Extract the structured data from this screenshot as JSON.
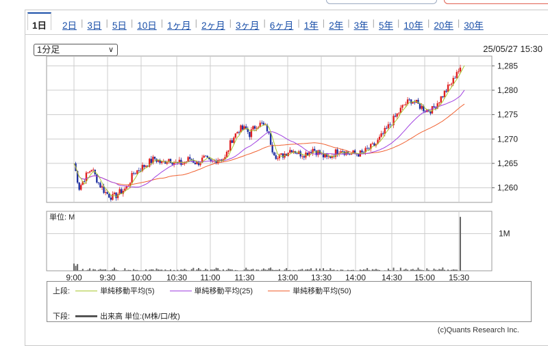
{
  "tabs": [
    "1日",
    "2日",
    "3日",
    "5日",
    "10日",
    "1ヶ月",
    "2ヶ月",
    "3ヶ月",
    "6ヶ月",
    "1年",
    "2年",
    "3年",
    "5年",
    "10年",
    "20年",
    "30年"
  ],
  "interval_select": "1分足",
  "timestamp": "25/05/27 15:30",
  "legend": {
    "upper_label": "上段:",
    "lower_label": "下段:",
    "items": [
      {
        "label": "単純移動平均(5)",
        "color": "#a8c830"
      },
      {
        "label": "単純移動平均(25)",
        "color": "#a040e0"
      },
      {
        "label": "単純移動平均(50)",
        "color": "#f06030"
      }
    ],
    "volume_label": "出来高 単位:(M株/口/枚)"
  },
  "copyright": "(c)Quants Research Inc.",
  "chart_data": {
    "type": "candlestick",
    "price_ticks": [
      "1,285",
      "1,280",
      "1,275",
      "1,270",
      "1,265",
      "1,260"
    ],
    "price_tick_values": [
      1285,
      1280,
      1275,
      1270,
      1265,
      1260
    ],
    "ylim": [
      1257,
      1287
    ],
    "x_ticks": [
      "9:00",
      "9:30",
      "10:00",
      "10:30",
      "11:00",
      "11:30",
      "13:00",
      "13:30",
      "14:00",
      "14:30",
      "15:00",
      "15:30"
    ],
    "series_path": [
      [
        0,
        1265
      ],
      [
        3,
        1260
      ],
      [
        6,
        1262
      ],
      [
        10,
        1264
      ],
      [
        14,
        1261
      ],
      [
        18,
        1259
      ],
      [
        22,
        1258
      ],
      [
        26,
        1259
      ],
      [
        30,
        1260
      ],
      [
        34,
        1263
      ],
      [
        38,
        1264
      ],
      [
        42,
        1265
      ],
      [
        46,
        1266
      ],
      [
        50,
        1265
      ],
      [
        54,
        1266
      ],
      [
        58,
        1265
      ],
      [
        62,
        1265
      ],
      [
        66,
        1266
      ],
      [
        70,
        1265
      ],
      [
        74,
        1266
      ],
      [
        78,
        1265
      ],
      [
        82,
        1266
      ],
      [
        86,
        1266
      ],
      [
        88,
        1268
      ],
      [
        90,
        1270
      ],
      [
        94,
        1272
      ],
      [
        98,
        1272
      ],
      [
        100,
        1271
      ],
      [
        102,
        1272
      ],
      [
        104,
        1273
      ],
      [
        107,
        1273
      ],
      [
        110,
        1272
      ],
      [
        113,
        1268
      ],
      [
        116,
        1266
      ],
      [
        120,
        1267
      ],
      [
        124,
        1268
      ],
      [
        128,
        1267
      ],
      [
        132,
        1267
      ],
      [
        136,
        1268
      ],
      [
        140,
        1267
      ],
      [
        144,
        1266
      ],
      [
        148,
        1267
      ],
      [
        152,
        1268
      ],
      [
        156,
        1267
      ],
      [
        160,
        1267
      ],
      [
        164,
        1267
      ],
      [
        168,
        1268
      ],
      [
        172,
        1269
      ],
      [
        176,
        1271
      ],
      [
        180,
        1273
      ],
      [
        184,
        1275
      ],
      [
        188,
        1277
      ],
      [
        192,
        1278
      ],
      [
        196,
        1277
      ],
      [
        200,
        1276
      ],
      [
        204,
        1276
      ],
      [
        208,
        1278
      ],
      [
        212,
        1280
      ],
      [
        216,
        1282
      ],
      [
        218,
        1284
      ]
    ],
    "volume_unit": "単位: M",
    "volume_tick": "1M",
    "volume_ylim": [
      0,
      1.6
    ],
    "volume_spike": 1.45,
    "sma5_color": "#a8c830",
    "sma25_color": "#a040e0",
    "sma50_color": "#f06030"
  }
}
